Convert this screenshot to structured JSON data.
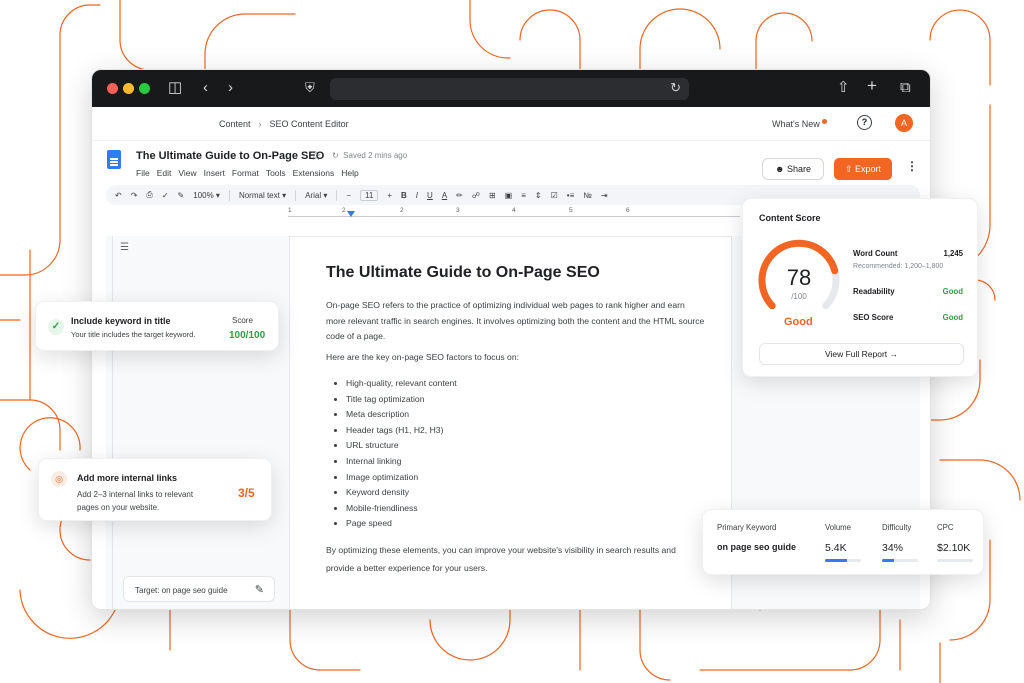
{
  "browser": {
    "url": ""
  },
  "app": {
    "breadcrumb": [
      "Content",
      "SEO Content Editor"
    ],
    "whats_new": "What's New",
    "avatar_initial": "A",
    "help": "?"
  },
  "doc": {
    "title": "The Ultimate Guide to On-Page SEO",
    "saved": "Saved 2 mins ago",
    "menus": [
      "File",
      "Edit",
      "View",
      "Insert",
      "Format",
      "Tools",
      "Extensions",
      "Help"
    ],
    "share_label": "Share",
    "export_label": "Export"
  },
  "toolbar": {
    "zoom": "100%",
    "style": "Normal text",
    "font": "Arial",
    "font_size": "11",
    "bold": "B",
    "italic": "I",
    "underline": "U",
    "text_color": "A"
  },
  "ruler": [
    "1",
    "2",
    "2",
    "3",
    "4",
    "5",
    "6"
  ],
  "content": {
    "heading": "The Ultimate Guide to On-Page SEO",
    "intro": "On-page SEO refers to the practice of optimizing individual web pages to rank higher and earn more relevant traffic in search engines. It involves optimizing both the content and the HTML source code of a page.",
    "factors_intro": "Here are the key on-page SEO factors to focus on:",
    "factors": [
      "High-quality, relevant content",
      "Title tag optimization",
      "Meta description",
      "Header tags (H1, H2, H3)",
      "URL structure",
      "Internal linking",
      "Image optimization",
      "Keyword density",
      "Mobile-friendliness",
      "Page speed"
    ],
    "closing": "By optimizing these elements, you can improve your website's visibility in search results and provide a better experience for your users."
  },
  "target_keyword": "Target: on page seo guide",
  "keyword_card": {
    "title": "Include keyword in title",
    "subtitle": "Your title includes the target keyword.",
    "score_label": "Score",
    "score_value": "100/100"
  },
  "links_card": {
    "title": "Add more internal links",
    "subtitle": "Add 2–3 internal links to relevant pages on your website.",
    "value": "3/5"
  },
  "score_card": {
    "title": "Content Score",
    "score": "78",
    "out_of": "/100",
    "score_fraction": 0.78,
    "rating": "Good",
    "word_count_label": "Word Count",
    "word_count_value": "1,245",
    "recommended": "Recommended: 1,200–1,800",
    "readability_label": "Readability",
    "readability_value": "Good",
    "seo_label": "SEO Score",
    "seo_value": "Good",
    "report_label": "View Full Report"
  },
  "primary_keyword": {
    "label": "Primary Keyword",
    "keyword": "on page seo guide",
    "volume_label": "Volume",
    "volume": "5.4K",
    "volume_fraction": 0.6,
    "difficulty_label": "Difficulty",
    "difficulty": "34%",
    "difficulty_fraction": 0.34,
    "cpc_label": "CPC",
    "cpc": "$2.10K",
    "cpc_fraction": 0.0
  },
  "colors": {
    "accent": "#f26522",
    "success": "#2ea043",
    "link": "#2f7cf6"
  }
}
